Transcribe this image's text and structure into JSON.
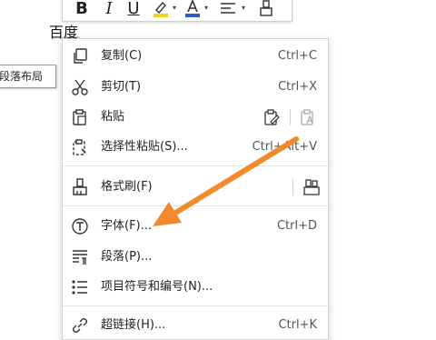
{
  "document": {
    "selected_text": "百度"
  },
  "tooltip": {
    "text": "段落布局"
  },
  "toolbar": {
    "bold_label": "B",
    "italic_label": "I",
    "underline_label": "U",
    "font_color_label": "A",
    "caret": "▾"
  },
  "menu": {
    "items": [
      {
        "label": "复制(C)",
        "shortcut": "Ctrl+C",
        "icon": "copy-icon"
      },
      {
        "label": "剪切(T)",
        "shortcut": "Ctrl+X",
        "icon": "scissors-icon"
      },
      {
        "label": "粘贴",
        "shortcut": "",
        "icon": "clipboard-icon"
      },
      {
        "label": "选择性粘贴(S)...",
        "shortcut": "Ctrl+Alt+V",
        "icon": "paste-special-icon"
      },
      {
        "label": "格式刷(F)",
        "shortcut": "",
        "icon": "format-painter-icon"
      },
      {
        "label": "字体(F)...",
        "shortcut": "Ctrl+D",
        "icon": "font-icon"
      },
      {
        "label": "段落(P)...",
        "shortcut": "",
        "icon": "paragraph-icon"
      },
      {
        "label": "项目符号和编号(N)...",
        "shortcut": "",
        "icon": "bullet-list-icon"
      },
      {
        "label": "超链接(H)...",
        "shortcut": "Ctrl+K",
        "icon": "hyperlink-icon"
      }
    ]
  },
  "colors": {
    "highlight_yellow": "#f5d21a",
    "font_color_blue": "#2f5ac8",
    "annotation_arrow": "#f08a2c",
    "selection_gray": "#d7d7d7"
  }
}
